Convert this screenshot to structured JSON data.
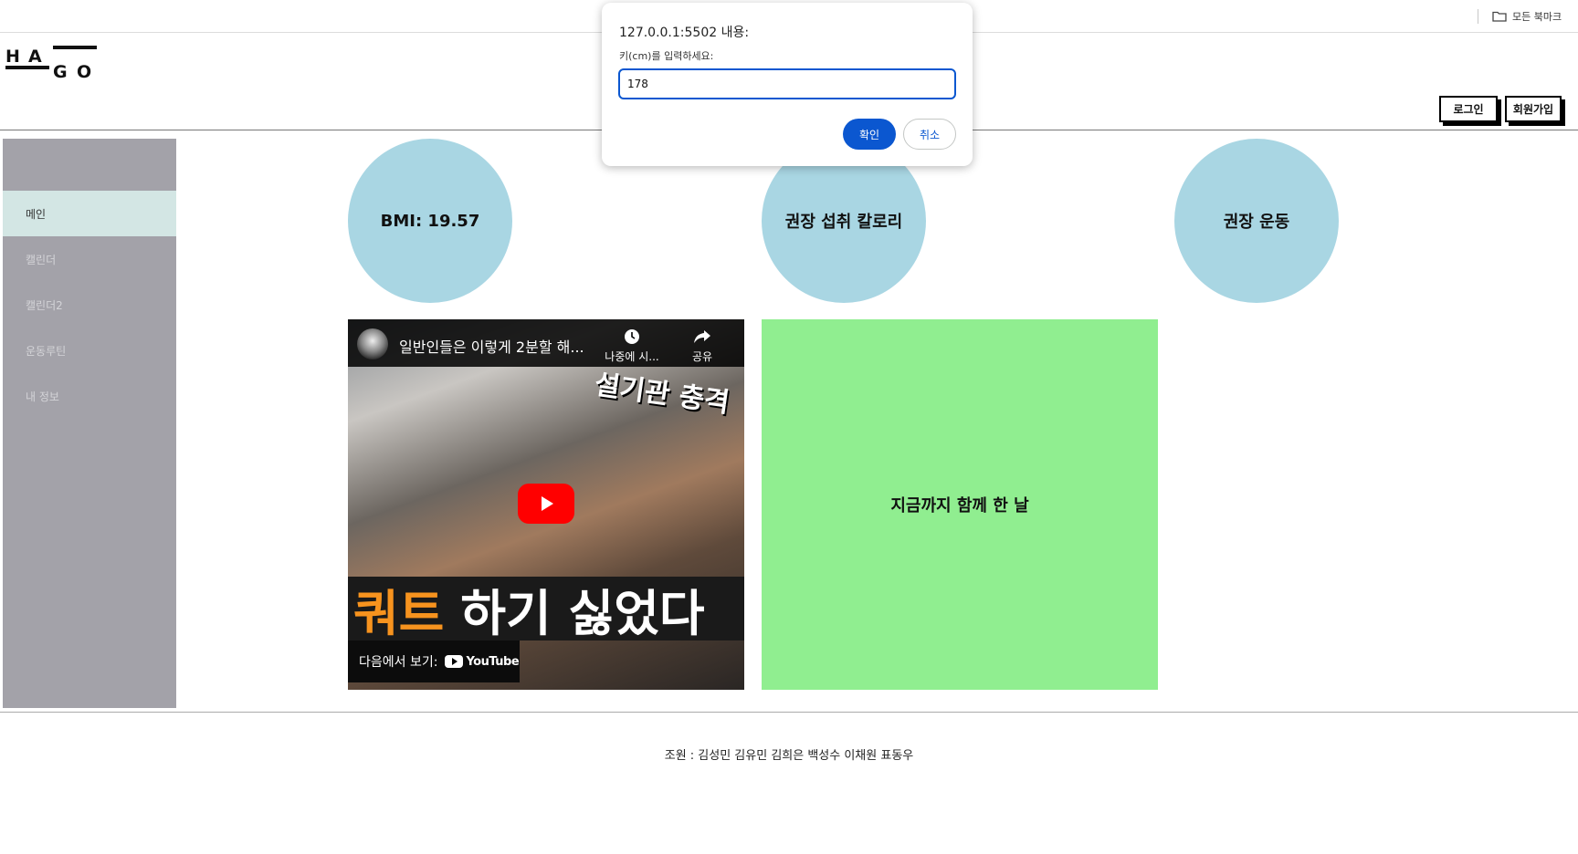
{
  "browser": {
    "bookmarks_label": "모든 북마크"
  },
  "header": {
    "logo_text": "HAGO",
    "login_label": "로그인",
    "signup_label": "회원가입"
  },
  "sidebar": {
    "items": [
      {
        "label": "메인",
        "active": true
      },
      {
        "label": "캘린더",
        "active": false
      },
      {
        "label": "캘린더2",
        "active": false
      },
      {
        "label": "운동루틴",
        "active": false
      },
      {
        "label": "내 정보",
        "active": false
      }
    ]
  },
  "circles": {
    "bmi": "BMI: 19.57",
    "calories": "권장 섭취 칼로리",
    "exercise": "권장 운동"
  },
  "video": {
    "title": "일반인들은 이렇게 2분할 해...",
    "watch_later_label": "나중에 시...",
    "share_label": "공유",
    "overlay_top": "설기관 충격",
    "overlay_bottom_highlight": "쿼트",
    "overlay_bottom_rest": "하기 싫었다",
    "watch_on_label": "다음에서 보기:",
    "youtube_label": "YouTube"
  },
  "green_box": {
    "label": "지금까지 함께 한 날"
  },
  "footer": {
    "text": "조원 : 김성민 김유민 김희은 백성수 이채원 표동우"
  },
  "dialog": {
    "title": "127.0.0.1:5502 내용:",
    "message": "키(cm)를 입력하세요:",
    "input_value": "178",
    "ok_label": "확인",
    "cancel_label": "취소"
  },
  "colors": {
    "sidebar_bg": "#a3a2a9",
    "sidebar_active": "#d3e6e4",
    "circle_bg": "#a9d6e3",
    "green_box": "#90ee90",
    "dialog_accent": "#0b57d0"
  }
}
